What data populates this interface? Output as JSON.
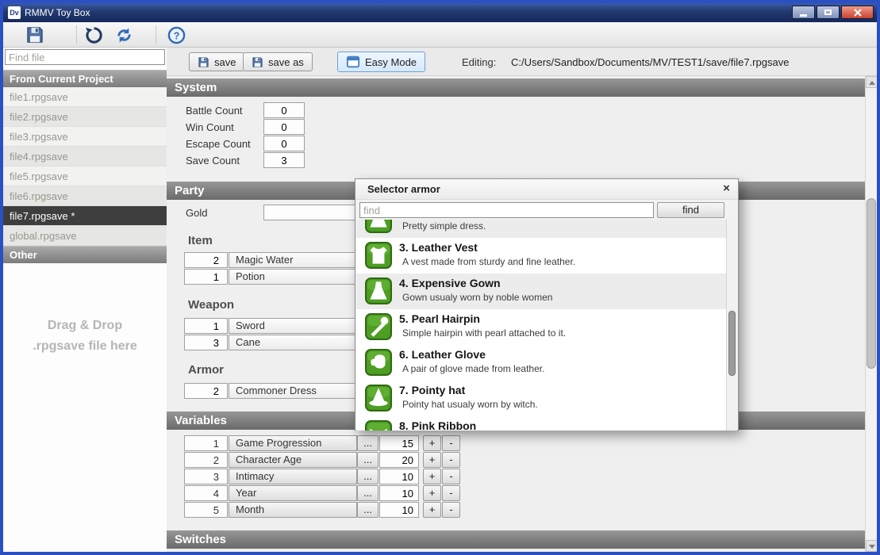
{
  "window": {
    "title": "RMMV Toy Box"
  },
  "toolbar": {
    "icons": [
      "save-icon",
      "reload-icon",
      "refresh-icon",
      "help-icon"
    ],
    "help_glyph": "?"
  },
  "sidebar": {
    "find_placeholder": "Find file",
    "section_current": "From Current Project",
    "files": [
      "file1.rpgsave",
      "file2.rpgsave",
      "file3.rpgsave",
      "file4.rpgsave",
      "file5.rpgsave",
      "file6.rpgsave",
      "file7.rpgsave *",
      "global.rpgsave"
    ],
    "selected_file": "file7.rpgsave *",
    "section_other": "Other",
    "drop_line1": "Drag & Drop",
    "drop_line2": ".rpgsave file here"
  },
  "editorbar": {
    "save_label": "save",
    "save_as_label": "save as",
    "easy_mode_label": "Easy Mode",
    "editing_label": "Editing:",
    "editing_path": "C:/Users/Sandbox/Documents/MV/TEST1/save/file7.rpgsave"
  },
  "system": {
    "header": "System",
    "rows": [
      {
        "label": "Battle Count",
        "value": "0"
      },
      {
        "label": "Win Count",
        "value": "0"
      },
      {
        "label": "Escape Count",
        "value": "0"
      },
      {
        "label": "Save Count",
        "value": "3"
      }
    ]
  },
  "party": {
    "header": "Party",
    "gold_label": "Gold",
    "gold_value": "",
    "item_header": "Item",
    "items": [
      {
        "count": "2",
        "name": "Magic Water"
      },
      {
        "count": "1",
        "name": "Potion"
      }
    ],
    "weapon_header": "Weapon",
    "weapons": [
      {
        "count": "1",
        "name": "Sword"
      },
      {
        "count": "3",
        "name": "Cane"
      }
    ],
    "armor_header": "Armor",
    "armors": [
      {
        "count": "2",
        "name": "Commoner Dress"
      }
    ]
  },
  "variables": {
    "header": "Variables",
    "ellipsis_label": "...",
    "plus_label": "+",
    "minus_label": "-",
    "rows": [
      {
        "id": "1",
        "name": "Game Progression",
        "value": "15"
      },
      {
        "id": "2",
        "name": "Character Age",
        "value": "20"
      },
      {
        "id": "3",
        "name": "Intimacy",
        "value": "10"
      },
      {
        "id": "4",
        "name": "Year",
        "value": "10"
      },
      {
        "id": "5",
        "name": "Month",
        "value": "10"
      }
    ]
  },
  "switches": {
    "header": "Switches"
  },
  "selector_dialog": {
    "title": "Selector armor",
    "close_glyph": "×",
    "find_placeholder": "find",
    "find_button": "find",
    "items": [
      {
        "title": "",
        "desc": "Pretty simple dress.",
        "icon": "dress-icon"
      },
      {
        "title": "3. Leather Vest",
        "desc": "A vest made from sturdy and fine leather.",
        "icon": "vest-icon"
      },
      {
        "title": "4. Expensive Gown",
        "desc": "Gown usualy worn by noble women",
        "icon": "gown-icon"
      },
      {
        "title": "5. Pearl Hairpin",
        "desc": "Simple hairpin with pearl attached to it.",
        "icon": "hairpin-icon"
      },
      {
        "title": "6. Leather Glove",
        "desc": "A pair of glove made from leather.",
        "icon": "glove-icon"
      },
      {
        "title": "7. Pointy hat",
        "desc": "Pointy hat usualy worn by witch.",
        "icon": "hat-icon"
      },
      {
        "title": "8. Pink Ribbon",
        "desc": "",
        "icon": "ribbon-icon"
      }
    ]
  },
  "colors": {
    "window_border": "#2b50c4",
    "title_bar": "#22396f",
    "section_header": "#7a7a7a",
    "selected_file_bg": "#3e3e3e",
    "easy_mode_border": "#6ba2d8",
    "icon_green": "#4d9e23"
  }
}
